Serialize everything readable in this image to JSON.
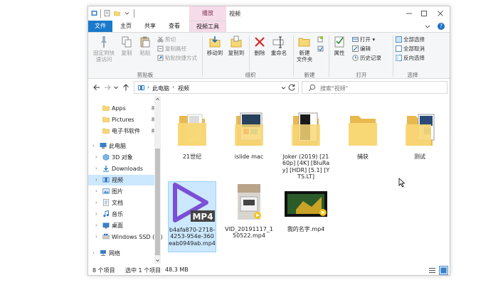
{
  "window": {
    "title": "视频",
    "tool_tab_top": "播放",
    "tabs": [
      {
        "label": "文件"
      },
      {
        "label": "主页"
      },
      {
        "label": "共享"
      },
      {
        "label": "查看"
      },
      {
        "label": "视频工具"
      }
    ]
  },
  "ribbon": {
    "clipboard": {
      "pin_label_1": "固定到快",
      "pin_label_2": "速访问",
      "copy_label": "复制",
      "paste_label": "粘贴",
      "cut_label": "剪切",
      "copy_path_label": "复制路径",
      "paste_shortcut_label": "粘贴快捷方式",
      "group_label": "剪贴板"
    },
    "organize": {
      "move_to_label": "移动到",
      "copy_to_label": "复制到",
      "delete_label": "删除",
      "rename_label": "重命名",
      "group_label": "组织"
    },
    "new": {
      "new_folder_label_1": "新建",
      "new_folder_label_2": "文件夹",
      "group_label": "新建"
    },
    "open": {
      "properties_label": "属性",
      "open_label": "打开",
      "edit_label": "编辑",
      "history_label": "历史记录",
      "group_label": "打开"
    },
    "select": {
      "select_all_label": "全部选择",
      "select_none_label": "全部取消",
      "invert_label": "反向选择",
      "group_label": "选择"
    }
  },
  "address": {
    "segment_1": "此电脑",
    "segment_2": "视频",
    "search_placeholder": "搜索\"视频\""
  },
  "nav_pane": [
    {
      "label": "Apps",
      "icon": "folder-icon"
    },
    {
      "label": "Pictures",
      "icon": "folder-icon"
    },
    {
      "label": "电子书软件",
      "icon": "folder-icon"
    },
    {
      "label": "此电脑",
      "icon": "computer-icon"
    },
    {
      "label": "3D 对象",
      "icon": "3d-objects-icon"
    },
    {
      "label": "Downloads",
      "icon": "download-icon"
    },
    {
      "label": "视频",
      "icon": "video-icon"
    },
    {
      "label": "图片",
      "icon": "pictures-icon"
    },
    {
      "label": "文档",
      "icon": "documents-icon"
    },
    {
      "label": "音乐",
      "icon": "music-icon"
    },
    {
      "label": "桌面",
      "icon": "desktop-icon"
    },
    {
      "label": "Windows SSD (C:)",
      "icon": "drive-icon"
    },
    {
      "label": "网络",
      "icon": "network-icon"
    }
  ],
  "files": [
    {
      "name": "21世纪",
      "kind": "folder"
    },
    {
      "name": "islide mac",
      "kind": "folder"
    },
    {
      "name": "Joker (2019) [2160p] [4K] [BluRay] [HDR] [5.1] [YTS.LT]",
      "kind": "folder"
    },
    {
      "name": "捕获",
      "kind": "folder"
    },
    {
      "name": "测试",
      "kind": "folder"
    },
    {
      "name": "b4afa870-2718-4253-954e-360eab0949ab.mp4",
      "kind": "mp4",
      "badge": "MP4"
    },
    {
      "name": "VID_20191117_150522.mp4",
      "kind": "video"
    },
    {
      "name": "我的名字.mp4",
      "kind": "video"
    }
  ],
  "status": {
    "count": "8 个项目",
    "selected": "选中 1 个项目",
    "size": "48.3 MB"
  },
  "colors": {
    "file_tab": "#1979ca",
    "tool_tab": "#f6dbe9",
    "selection": "#cce8ff",
    "folder": "#f8d775"
  }
}
